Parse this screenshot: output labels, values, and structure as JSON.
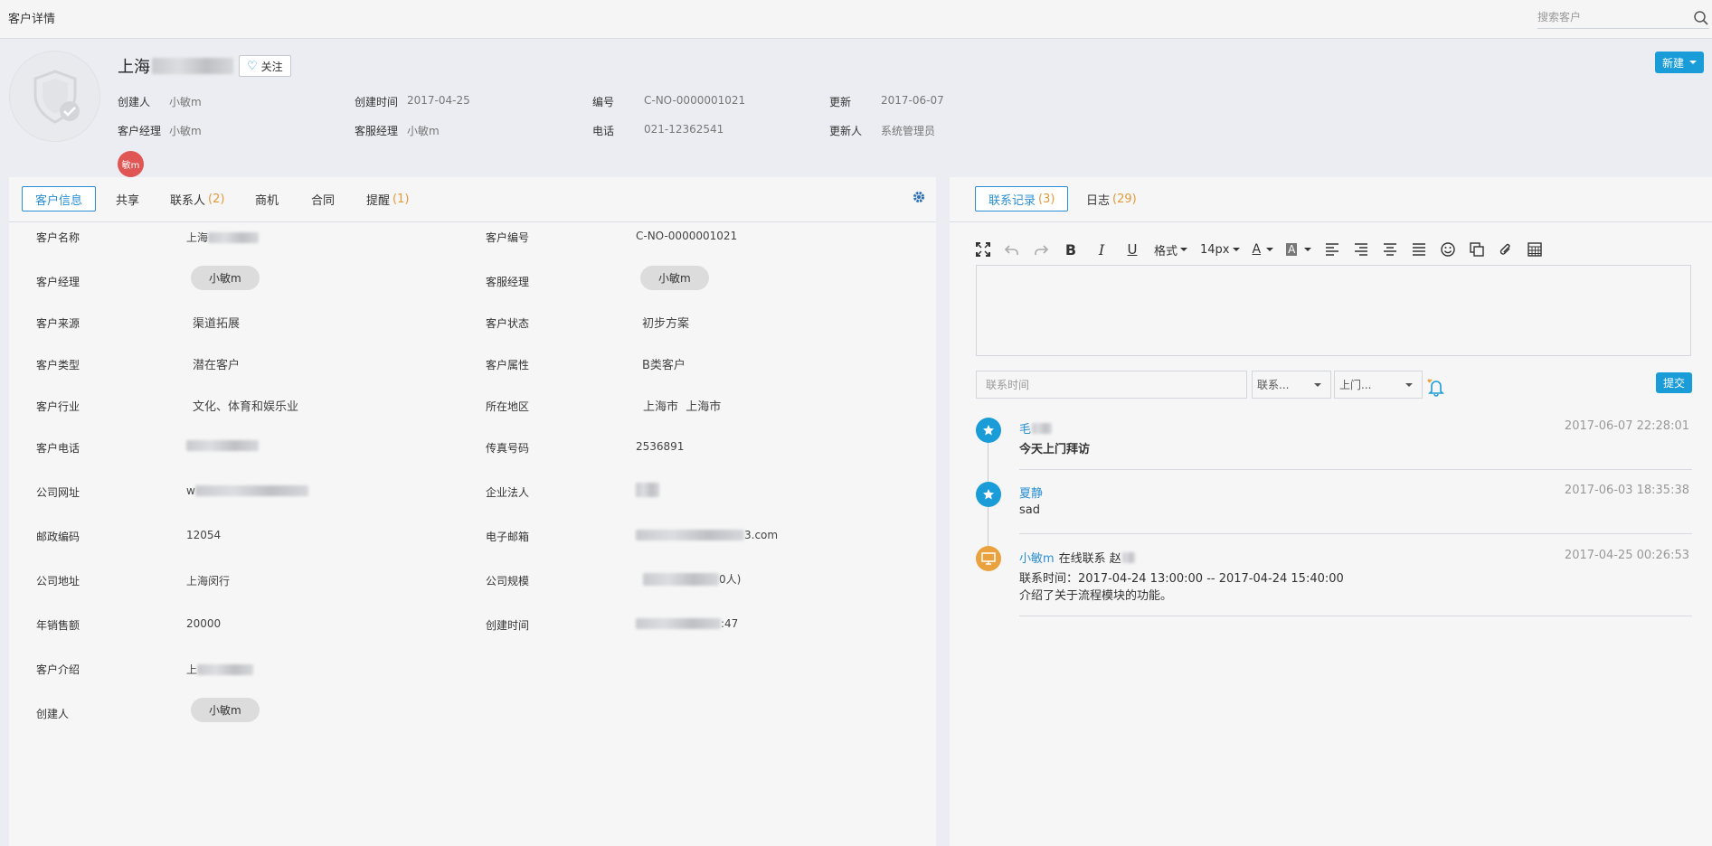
{
  "topbar": {
    "title": "客户详情",
    "search_placeholder": "搜索客户"
  },
  "header": {
    "name": "上海",
    "follow_label": "关注",
    "new_label": "新建",
    "tag_label": "敏m",
    "meta": {
      "creator_label": "创建人",
      "creator": "小敏m",
      "created_label": "创建时间",
      "created": "2017-04-25",
      "number_label": "编号",
      "number": "C-NO-0000001021",
      "updated_label": "更新",
      "updated": "2017-06-07",
      "manager_label": "客户经理",
      "manager": "小敏m",
      "service_label": "客服经理",
      "service": "小敏m",
      "phone_label": "电话",
      "phone": "021-12362541",
      "updater_label": "更新人",
      "updater": "系统管理员"
    }
  },
  "left_tabs": {
    "info": "客户信息",
    "share": "共享",
    "contacts": "联系人",
    "contacts_count": "(2)",
    "opportunity": "商机",
    "contract": "合同",
    "reminder": "提醒",
    "reminder_count": "(1)"
  },
  "fields": {
    "name_label": "客户名称",
    "name_value": "上海",
    "code_label": "客户编号",
    "code_value": "C-NO-0000001021",
    "manager_label": "客户经理",
    "manager_value": "小敏m",
    "service_label": "客服经理",
    "service_value": "小敏m",
    "source_label": "客户来源",
    "source_value": "渠道拓展",
    "status_label": "客户状态",
    "status_value": "初步方案",
    "type_label": "客户类型",
    "type_value": "潜在客户",
    "attr_label": "客户属性",
    "attr_value": "B类客户",
    "industry_label": "客户行业",
    "industry_value": "文化、体育和娱乐业",
    "region_label": "所在地区",
    "region_value": "上海市  上海市",
    "phone_label": "客户电话",
    "fax_label": "传真号码",
    "fax_value": "2536891",
    "website_label": "公司网址",
    "website_value": "w",
    "legal_label": "企业法人",
    "zip_label": "邮政编码",
    "zip_value": "12054",
    "email_label": "电子邮箱",
    "email_value": "3.com",
    "address_label": "公司地址",
    "address_value": "上海闵行",
    "scale_label": "公司规模",
    "scale_value": "0人)",
    "sales_label": "年销售额",
    "sales_value": "20000",
    "ctime_label": "创建时间",
    "ctime_value": ":47",
    "intro_label": "客户介绍",
    "intro_value": "上",
    "creator_label": "创建人",
    "creator_value": "小敏m"
  },
  "right_tabs": {
    "records": "联系记录",
    "records_count": "(3)",
    "log": "日志",
    "log_count": "(29)"
  },
  "editor": {
    "format_label": "格式",
    "size_label": "14px",
    "time_placeholder": "联系时间",
    "select1": "联系...",
    "select2": "上门...",
    "submit_label": "提交"
  },
  "timeline": [
    {
      "name": "毛",
      "time": "2017-06-07 22:28:01",
      "text": "今天上门拜访",
      "icon": "star-icon"
    },
    {
      "name": "夏静",
      "time": "2017-06-03 18:35:38",
      "text": "sad",
      "icon": "star-icon"
    },
    {
      "name": "小敏m",
      "action": "在线联系 赵",
      "time": "2017-04-25 00:26:53",
      "line1": "联系时间：2017-04-24 13:00:00 -- 2017-04-24 15:40:00",
      "line2": "介绍了关于流程模块的功能。",
      "icon": "monitor-icon"
    }
  ],
  "colors": {
    "accent": "#1a9cd8",
    "count": "#e39a3c",
    "tag": "#e05655",
    "timeline_orange": "#eaa23e"
  }
}
